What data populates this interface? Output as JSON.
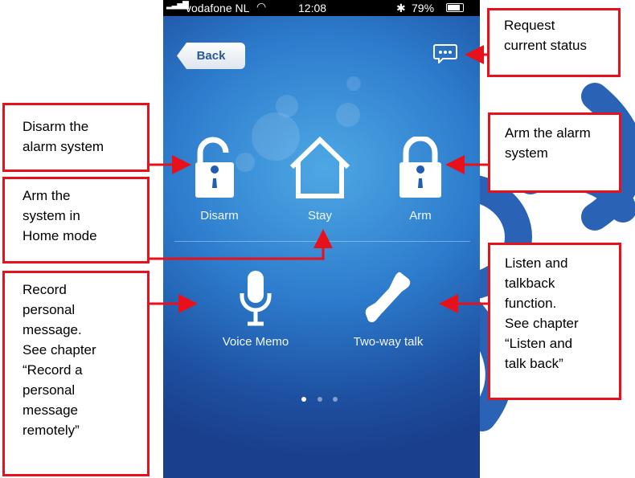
{
  "statusbar": {
    "carrier": "vodafone NL",
    "time": "12:08",
    "battery": "79%"
  },
  "header": {
    "back_label": "Back",
    "status_icon": "message-bubble-icon"
  },
  "actions": {
    "disarm": "Disarm",
    "stay": "Stay",
    "arm": "Arm",
    "voice_memo": "Voice Memo",
    "two_way": "Two-way talk"
  },
  "pager": {
    "pages": 3,
    "current": 1
  },
  "annotations": {
    "request_status": [
      "Request",
      "current status"
    ],
    "disarm": [
      "Disarm the",
      "alarm system"
    ],
    "arm": [
      "Arm the alarm",
      "system"
    ],
    "stay": [
      "Arm the",
      "system in",
      "Home mode"
    ],
    "record": [
      "Record",
      "personal",
      "message.",
      "See chapter",
      "“Record a",
      "personal",
      "message",
      "remotely”"
    ],
    "listen": [
      "Listen and",
      "talkback",
      "function.",
      "See chapter",
      "“Listen and",
      "talk back”"
    ]
  },
  "colors": {
    "annotation": "#e8101a",
    "watermark": "#2a63b5"
  }
}
